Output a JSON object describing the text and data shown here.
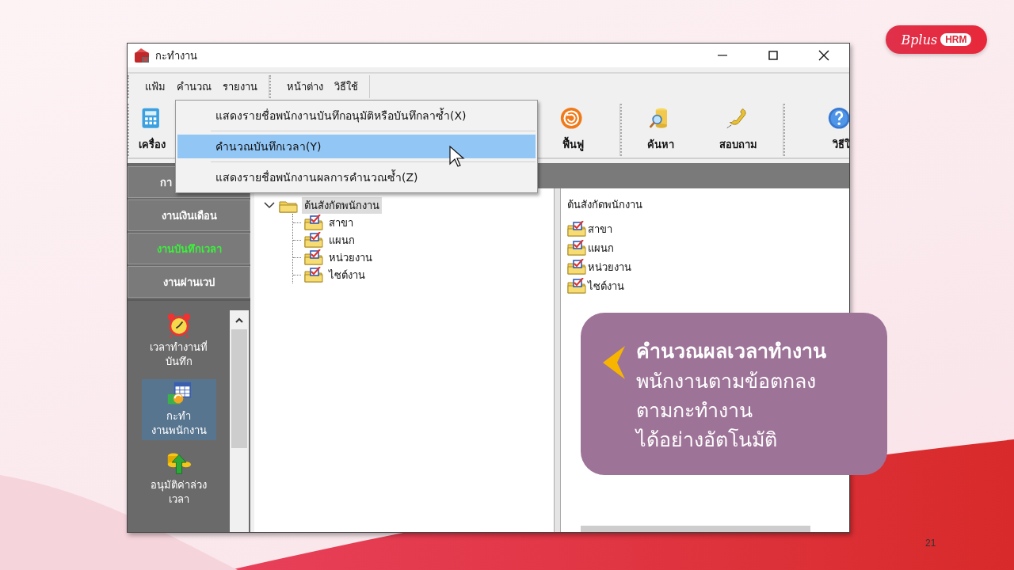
{
  "slide": {
    "logo": {
      "script": "Bplus",
      "badge": "HRM"
    },
    "page_number": "21"
  },
  "window": {
    "title": "กะทำงาน"
  },
  "menu_groups": [
    {
      "items": [
        "แฟ้ม",
        "คำนวณ",
        "รายงาน"
      ]
    },
    {
      "items": [
        "หน้าต่าง",
        "วิธีใช้"
      ]
    }
  ],
  "toolbar_groups": [
    {
      "buttons": [
        {
          "label": "เครื่อง",
          "kind": "calculator"
        }
      ]
    },
    {
      "buttons": [
        {
          "label": "ฟื้นฟู",
          "kind": "refresh"
        }
      ]
    },
    {
      "buttons": [
        {
          "label": "ค้นหา",
          "kind": "search"
        },
        {
          "label": "สอบถาม",
          "kind": "phone"
        }
      ]
    },
    {
      "buttons": [
        {
          "label": "วิธีใ",
          "kind": "help"
        }
      ]
    }
  ],
  "dropdown": {
    "items": [
      {
        "label": "แสดงรายชื่อพนักงานบันทึกอนุมัติหรือบันทึกลาซ้ำ(X)",
        "selected": false
      },
      {
        "label": "คำนวณบันทึกเวลา(Y)",
        "selected": true
      },
      {
        "label": "แสดงรายชื่อพนักงานผลการคำนวณซ้ำ(Z)",
        "selected": false
      }
    ]
  },
  "nav_buttons": [
    {
      "label": "กา",
      "selected": false
    },
    {
      "label": "งานเงินเดือน",
      "selected": false
    },
    {
      "label": "งานบันทึกเวลา",
      "selected": true
    },
    {
      "label": "งานผ่านเวป",
      "selected": false
    }
  ],
  "nav_items": [
    {
      "label": "เวลาทำงานที่\nบันทึก",
      "kind": "clock",
      "selected": false
    },
    {
      "label": "กะทำ\nงานพนักงาน",
      "kind": "shift",
      "selected": true
    },
    {
      "label": "อนุมัติค่าล่วง\nเวลา",
      "kind": "approve",
      "selected": false
    }
  ],
  "tree": {
    "label": "ต้นสังกัดพนักงาน",
    "expanded": true,
    "selected": true,
    "children": [
      {
        "label": "สาขา",
        "checked": true,
        "selected": false
      },
      {
        "label": "แผนก",
        "checked": true,
        "selected": false
      },
      {
        "label": "หน่วยงาน",
        "checked": true,
        "selected": false
      },
      {
        "label": "ไซต์งาน",
        "checked": true,
        "selected": false
      }
    ]
  },
  "detail": {
    "title": "ต้นสังกัดพนักงาน",
    "items": [
      {
        "label": "สาขา",
        "checked": true
      },
      {
        "label": "แผนก",
        "checked": true
      },
      {
        "label": "หน่วยงาน",
        "checked": true
      },
      {
        "label": "ไซต์งาน",
        "checked": true
      }
    ]
  },
  "callout": {
    "heading": "คำนวณผลเวลาทำงาน",
    "body": "พนักงานตามข้อตกลง\nตามกะทำงาน\nได้อย่างอัตโนมัติ"
  }
}
